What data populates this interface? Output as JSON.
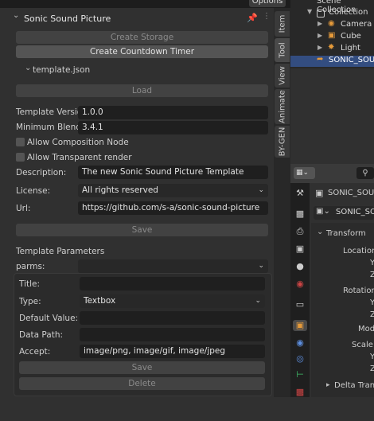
{
  "top": {
    "options_label": "Options"
  },
  "panel": {
    "title": "Sonic Sound Picture",
    "create_storage": "Create Storage",
    "create_countdown": "Create Countdown Timer",
    "template_file": "template.json",
    "load": "Load",
    "template_version_label": "Template Version:",
    "template_version": "1.0.0",
    "min_blender_label": "Minimum Blender ...",
    "min_blender": "3.4.1",
    "allow_composition": "Allow Composition Node",
    "allow_transparent": "Allow Transparent render",
    "description_label": "Description:",
    "description": "The new Sonic Sound Picture Template",
    "license_label": "License:",
    "license": "All rights reserved",
    "url_label": "Url:",
    "url": "https://github.com/s-a/sonic-sound-picture",
    "save": "Save",
    "template_params": "Template Parameters",
    "parms_label": "parms:",
    "parms_value": "",
    "title_label": "Title:",
    "title_value": "",
    "type_label": "Type:",
    "type_value": "Textbox",
    "default_label": "Default Value:",
    "default_value": "",
    "datapath_label": "Data Path:",
    "datapath_value": "",
    "accept_label": "Accept:",
    "accept_value": "image/png, image/gif, image/jpeg",
    "save2": "Save",
    "delete": "Delete"
  },
  "tabs": [
    "Item",
    "Tool",
    "View",
    "Animate",
    "BY-GEN"
  ],
  "outliner": {
    "scene_collection": "Scene Collection",
    "collection": "Collection",
    "camera": "Camera",
    "cube": "Cube",
    "light": "Light",
    "selected": "SONIC_SOUND"
  },
  "properties": {
    "object_name": "SONIC_SOUND_",
    "object_name2": "SONIC_SOUN",
    "transform": "Transform",
    "location": "Location X",
    "rotation": "Rotation X",
    "mode": "Mode",
    "scale": "Scale X",
    "y": "Y",
    "z": "Z",
    "delta": "Delta Transfo"
  },
  "colors": {
    "accent_selected": "#334d80",
    "panel_bg": "#303030"
  }
}
